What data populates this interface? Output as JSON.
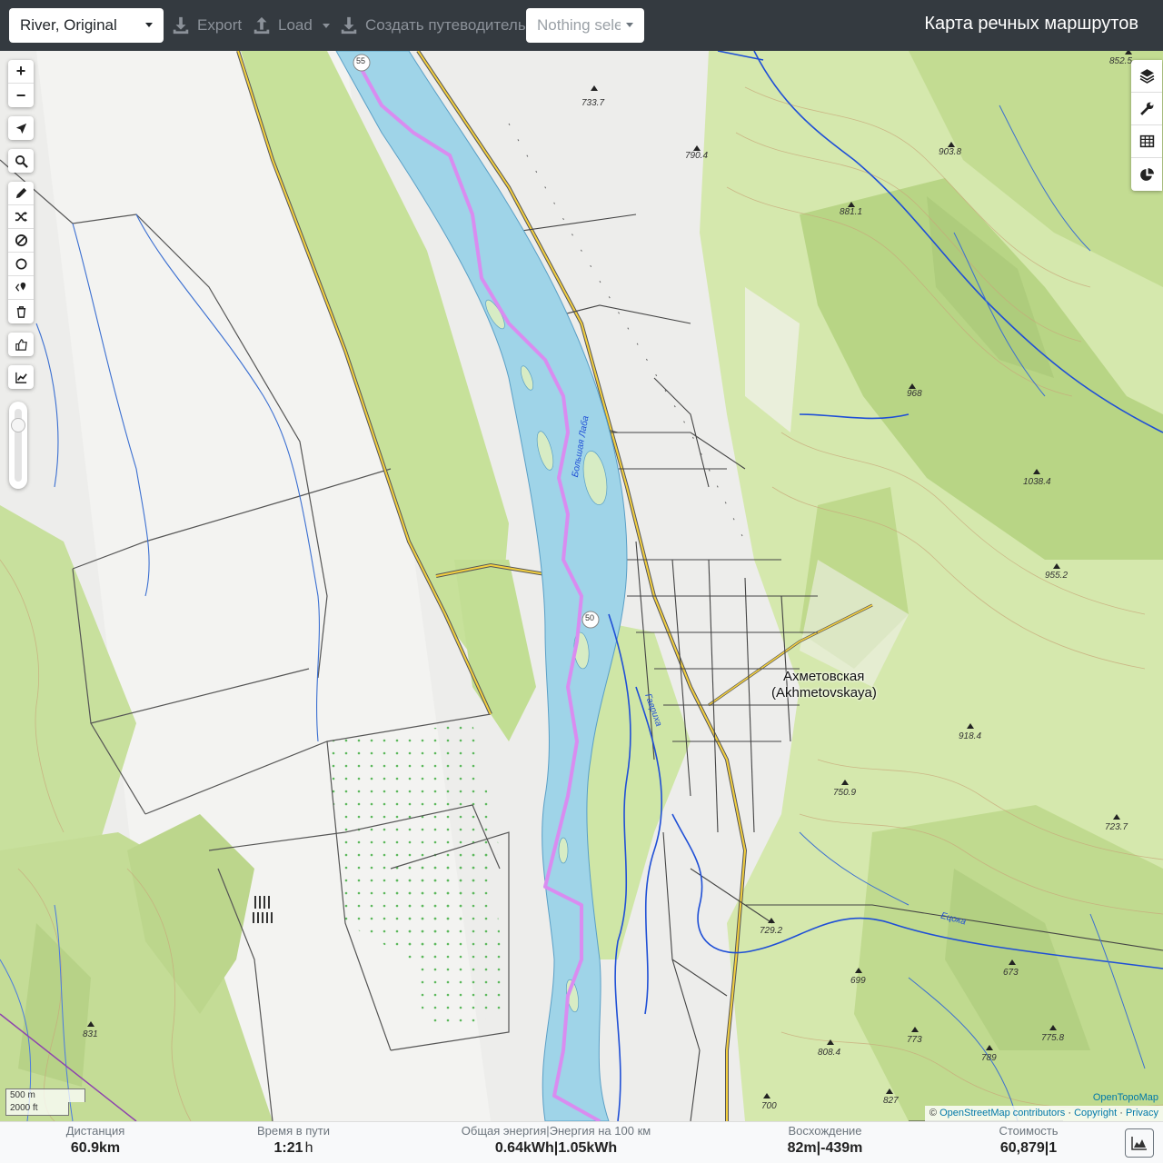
{
  "topbar": {
    "profile_select": "River, Original",
    "export_label": "Export",
    "load_label": "Load",
    "guide_label": "Создать путеводитель",
    "nothing_selected": "Nothing selected",
    "brand": "Карта речных маршрутов"
  },
  "map": {
    "town_name": "Ахметовская",
    "town_name_latin": "(Akhmetovskaya)",
    "river_label_1": "Большая Лаба",
    "river_label_2": "Гавриха",
    "river_label_3": "Ецока",
    "route_marker_55": "55",
    "route_marker_50": "50",
    "elevations": [
      "852.5",
      "733.7",
      "790.4",
      "903.8",
      "881.1",
      "968",
      "1038.4",
      "955.2",
      "918.4",
      "750.9",
      "723.7",
      "729.2",
      "673",
      "699",
      "775.8",
      "773",
      "808.4",
      "789",
      "831",
      "700",
      "827"
    ],
    "scale_metric": "500 m",
    "scale_imperial": "2000 ft",
    "attribution_tile": "OpenTopoMap",
    "attribution_osm": "OpenStreetMap contributors",
    "attribution_copyright": "Copyright",
    "attribution_privacy": "Privacy",
    "attribution_prefix": "©",
    "sep": "·"
  },
  "controls": {
    "left": [
      "zoom-in",
      "zoom-out",
      "locate",
      "search",
      "draw",
      "reroute",
      "no-go",
      "circle",
      "poi",
      "delete",
      "thumb",
      "elevation"
    ],
    "right": [
      "layers",
      "settings",
      "table",
      "stats"
    ]
  },
  "stats": {
    "distance_label": "Дистанция",
    "distance_value": "60.9",
    "distance_unit": "km",
    "time_label": "Время в пути",
    "time_value": "1:21",
    "time_unit": "h",
    "energy_label": "Общая энергия|Энергия на 100 км",
    "energy_value_1": "0.64",
    "energy_unit_1": "kWh",
    "energy_value_2": "1.05",
    "energy_unit_2": "kWh",
    "ascent_label": "Восхождение",
    "ascent_value_1": "82",
    "ascent_unit_1": "m",
    "ascent_value_2": "-439",
    "ascent_unit_2": "m",
    "cost_label": "Стоимость",
    "cost_value": "60,879",
    "cost_value_2": "1",
    "pipe": "|"
  },
  "colors": {
    "topbar_bg": "#343a40",
    "route": "#d98cf0",
    "river_fill": "#9fd4e8",
    "forest": "#c5df98",
    "contour": "#c8a77a"
  }
}
